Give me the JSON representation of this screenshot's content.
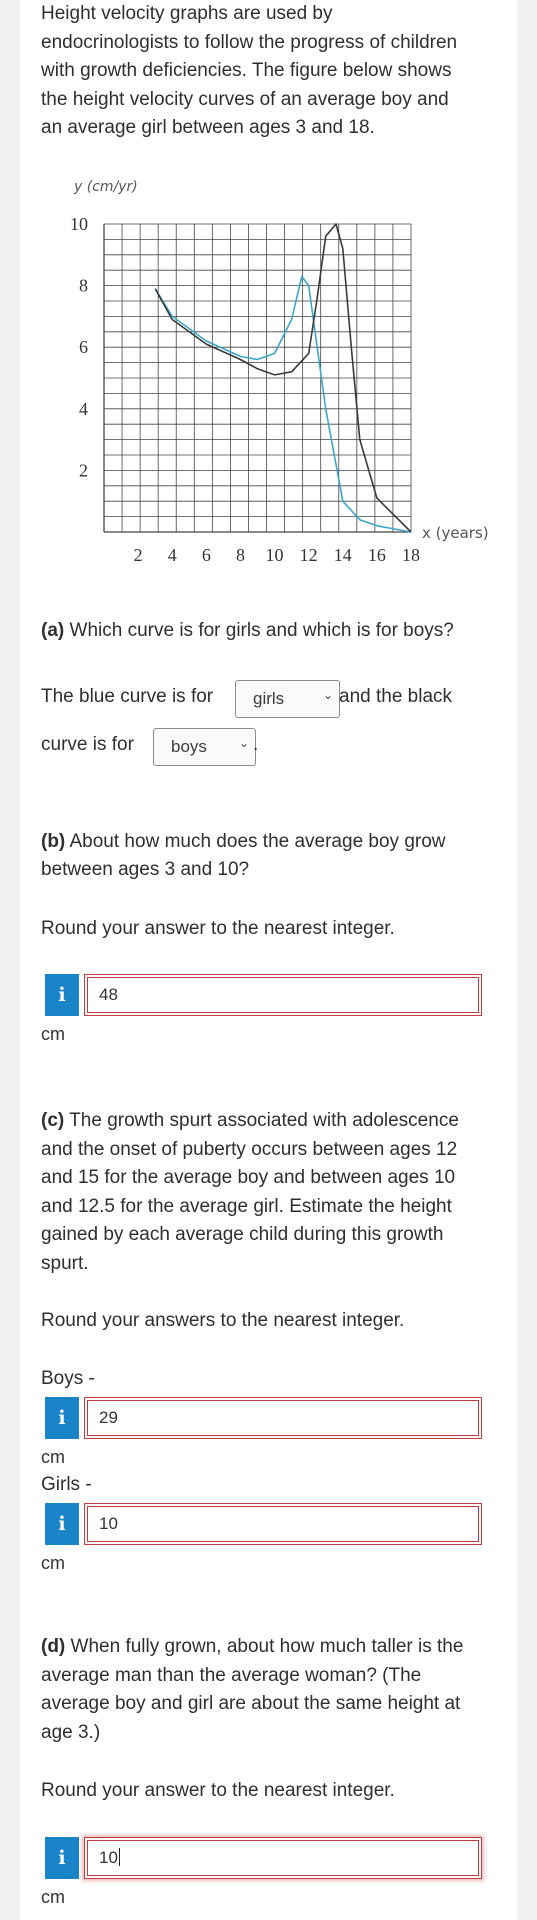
{
  "intro": {
    "lines": [
      "Height velocity graphs are used by",
      "endocrinologists to follow the progress of children",
      "with growth deficiencies. The figure below shows",
      "the height velocity curves of an average boy and",
      "an average girl between ages 3 and 18."
    ]
  },
  "chart_data": {
    "type": "line",
    "ylabel": "y (cm/yr)",
    "xlabel": "x (years)",
    "xlim": [
      0,
      18
    ],
    "ylim": [
      0,
      10
    ],
    "x_ticks": [
      2,
      4,
      6,
      8,
      10,
      12,
      14,
      16,
      18
    ],
    "y_ticks": [
      2,
      4,
      6,
      8,
      10
    ],
    "grid": true,
    "series": [
      {
        "color": "#3ba8c9",
        "x": [
          3,
          4,
          6,
          8,
          9,
          10,
          11,
          11.6,
          12,
          12.5,
          13,
          14,
          15,
          16,
          17,
          18
        ],
        "y": [
          7.9,
          7.0,
          6.2,
          5.7,
          5.6,
          5.8,
          6.9,
          8.3,
          8.0,
          6.0,
          4.0,
          1.0,
          0.4,
          0.2,
          0.1,
          0.0
        ]
      },
      {
        "color": "#3a3a3a",
        "x": [
          3,
          4,
          6,
          8,
          9,
          10,
          11,
          12,
          12.5,
          13,
          13.6,
          14,
          14.5,
          15,
          16,
          18
        ],
        "y": [
          7.9,
          6.9,
          6.1,
          5.6,
          5.3,
          5.1,
          5.2,
          5.8,
          7.6,
          9.6,
          10.0,
          9.2,
          6.0,
          3.0,
          1.1,
          0.0
        ]
      }
    ]
  },
  "part_a": {
    "question_label": "(a)",
    "question": "Which curve is for girls and which is for boys?",
    "line1_text": "The blue curve is for",
    "line1_after": "and the black",
    "line2_text": "curve is for",
    "line2_after": ".",
    "select1_value": "girls",
    "select2_value": "boys"
  },
  "part_b": {
    "question_label": "(b)",
    "question_lines": [
      "About how much does the average boy grow",
      "between ages 3 and 10?"
    ],
    "instruction": "Round your answer to the nearest integer.",
    "answer": "48",
    "unit": "cm"
  },
  "part_c": {
    "question_label": "(c)",
    "question_lines": [
      "The growth spurt associated with adolescence",
      "and the onset of puberty occurs between ages 12",
      "and 15 for the average boy and between ages 10",
      "and 12.5 for the average girl. Estimate the height",
      "gained by each average child during this growth",
      "spurt."
    ],
    "instruction": "Round your answers to the nearest integer.",
    "boys_label": "Boys -",
    "boys_answer": "29",
    "girls_label": "Girls -",
    "girls_answer": "10",
    "unit": "cm"
  },
  "part_d": {
    "question_label": "(d)",
    "question_lines": [
      "When fully grown, about how much taller is the",
      "average man than the average woman? (The",
      "average boy and girl are about the same height at",
      "age 3.)"
    ],
    "instruction": "Round your answer to the nearest integer.",
    "answer": "10",
    "unit": "cm"
  },
  "icons": {
    "info": "i",
    "chevron": "⌄"
  }
}
